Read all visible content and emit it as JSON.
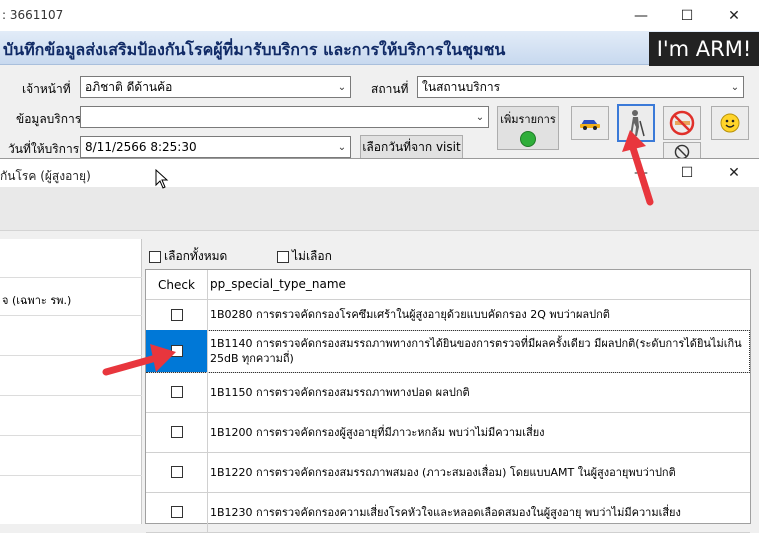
{
  "main_window": {
    "title": ": 3661107",
    "header": "บันทึกข้อมูลส่งเสริมป้องกันโรคผู้ที่มารับบริการ และการให้บริการในชุมชน",
    "brand": "I'm ARM!",
    "fields": {
      "officer_label": "เจ้าหน้าที่",
      "officer_value": "อภิชาติ ดีด้านค้อ",
      "place_label": "สถานที่",
      "place_value": "ในสถานบริการ",
      "service_label": "ข้อมูลบริการ",
      "service_value": "",
      "date_label": "วันที่ให้บริการ",
      "date_value": "8/11/2566 8:25:30"
    },
    "buttons": {
      "add_item": "เพิ่มรายการ",
      "select_date": "เลือกวันที่จาก visit"
    }
  },
  "dialog": {
    "title": "กันโรค (ผู้สูงอายุ)",
    "left_item": "จ (เฉพาะ รพ.)",
    "select_all": "เลือกทั้งหมด",
    "select_none": "ไม่เลือก",
    "columns": [
      "Check",
      "pp_special_type_name"
    ],
    "rows": [
      {
        "name": "1B0280 การตรวจคัดกรองโรคซึมเศร้าในผู้สูงอายุด้วยแบบคัดกรอง 2Q พบว่าผลปกติ",
        "checked": false,
        "selected": false
      },
      {
        "name": "1B1140 การตรวจคัดกรองสมรรถภาพทางการได้ยินของการตรวจที่มีผลครั้งเดียว มีผลปกติ(ระดับการได้ยินไม่เกิน 25dB ทุกความถี่)",
        "checked": false,
        "selected": true
      },
      {
        "name": "1B1150 การตรวจคัดกรองสมรรถภาพทางปอด ผลปกติ",
        "checked": false,
        "selected": false
      },
      {
        "name": "1B1200 การตรวจคัดกรองผู้สูงอายุที่มีภาวะหกล้ม พบว่าไม่มีความเสี่ยง",
        "checked": false,
        "selected": false
      },
      {
        "name": "1B1220 การตรวจคัดกรองสมรรถภาพสมอง (ภาวะสมองเสื่อม) โดยแบบAMT ในผู้สูงอายุพบว่าปกติ",
        "checked": false,
        "selected": false
      },
      {
        "name": "1B1230 การตรวจคัดกรองความเสี่ยงโรคหัวใจและหลอดเลือดสมองในผู้สูงอายุ พบว่าไม่มีความเสี่ยง",
        "checked": false,
        "selected": false
      }
    ]
  },
  "colors": {
    "header_text": "#102a66",
    "selection": "#0078d7",
    "annotation_arrow": "#e8363d"
  },
  "icons": [
    "minimize-icon",
    "maximize-icon",
    "close-icon",
    "car-icon",
    "elderly-person-icon",
    "no-smoking-icon",
    "smiley-icon",
    "no-sign-icon",
    "refresh-green-icon",
    "mouse-cursor-icon"
  ]
}
